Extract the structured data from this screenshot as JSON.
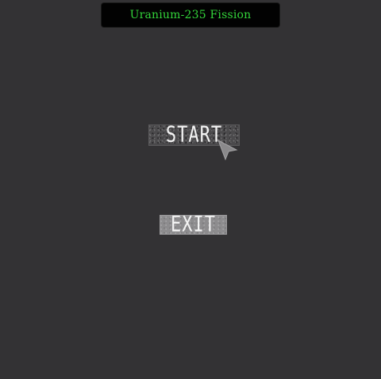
{
  "title": "Uranium-235 Fission",
  "menu": {
    "start_label": "START",
    "exit_label": "EXIT"
  },
  "colors": {
    "background": "#333234",
    "title_bar": "#020202",
    "title_text": "#33d43a",
    "start_button": "#4b4a4c",
    "exit_button": "#8d8c8e",
    "button_text": "#f4f4f4"
  },
  "icons": {
    "cursor": "arrow-pointer-icon"
  }
}
